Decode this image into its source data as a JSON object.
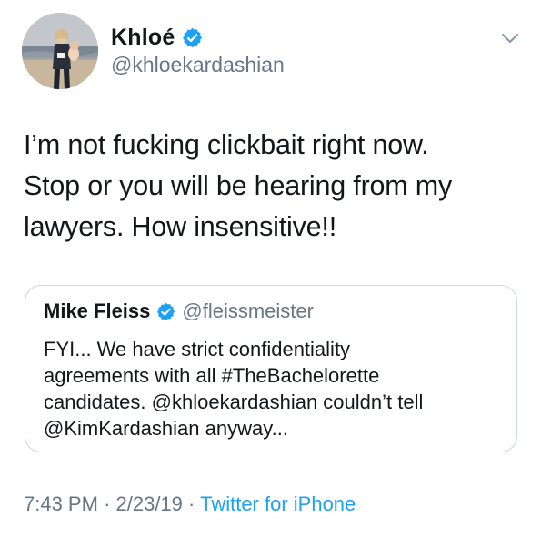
{
  "author": {
    "display_name": "Khloé",
    "handle": "@khloekardashian",
    "verified": true
  },
  "tweet": {
    "text_lines": [
      "I’m not fucking clickbait right now.",
      "Stop or you will be hearing from my",
      "lawyers. How insensitive!!"
    ]
  },
  "quoted_tweet": {
    "display_name": "Mike Fleiss",
    "handle": "@fleissmeister",
    "verified": true,
    "text_lines": [
      "FYI... We have strict confidentiality",
      "agreements with all #TheBachelorette",
      "candidates. @khloekardashian couldn’t tell",
      "@KimKardashian anyway..."
    ]
  },
  "footer": {
    "time": "7:43 PM",
    "separator": "·",
    "date": "2/23/19",
    "source": "Twitter for iPhone"
  },
  "icons": {
    "verified": "verified-badge-icon",
    "menu": "chevron-down-icon"
  },
  "colors": {
    "accent": "#1da1f2",
    "text": "#14171a",
    "secondary_text": "#657786",
    "border": "#ccd6dd"
  }
}
